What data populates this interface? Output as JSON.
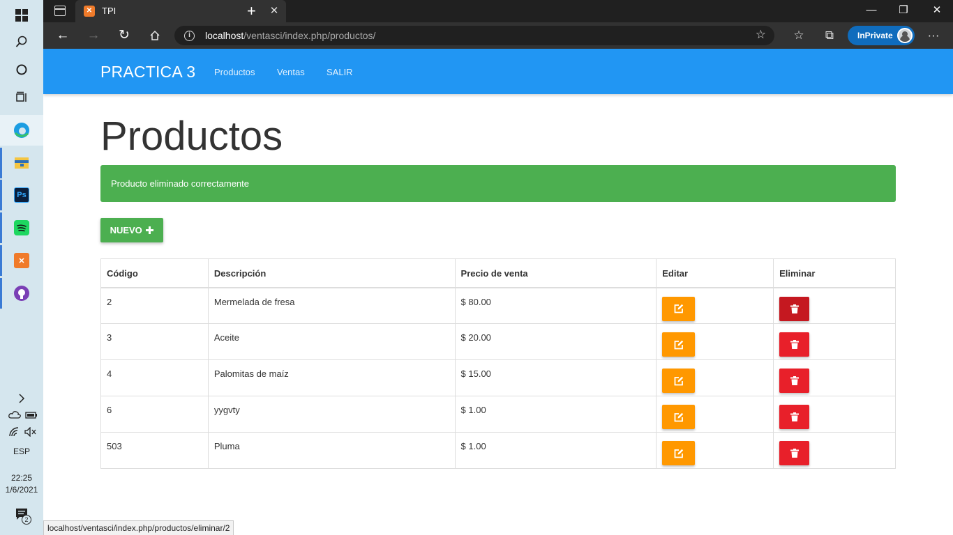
{
  "browser": {
    "tab_title": "TPI",
    "tab_favicon": "xampp-icon",
    "url_host": "localhost",
    "url_path": "/ventasci/index.php/productos/",
    "inprivate_label": "InPrivate"
  },
  "site": {
    "brand": "PRACTICA 3",
    "nav": [
      "Productos",
      "Ventas",
      "SALIR"
    ]
  },
  "page": {
    "title": "Productos",
    "alert": "Producto eliminado correctamente",
    "new_button": "NUEVO",
    "table": {
      "headers": [
        "Código",
        "Descripción",
        "Precio de venta",
        "Editar",
        "Eliminar"
      ],
      "rows": [
        {
          "code": "2",
          "desc": "Mermelada de fresa",
          "price": "$ 80.00"
        },
        {
          "code": "3",
          "desc": "Aceite",
          "price": "$ 20.00"
        },
        {
          "code": "4",
          "desc": "Palomitas de maíz",
          "price": "$ 15.00"
        },
        {
          "code": "6",
          "desc": "yygvty",
          "price": "$ 1.00"
        },
        {
          "code": "503",
          "desc": "Pluma",
          "price": "$ 1.00"
        }
      ]
    }
  },
  "status_url": "localhost/ventasci/index.php/productos/eliminar/2",
  "taskbar": {
    "lang": "ESP",
    "time": "22:25",
    "date": "1/6/2021",
    "notifications": "2"
  },
  "colors": {
    "navbar": "#2196f3",
    "success": "#4caf50",
    "edit": "#ff9800",
    "delete": "#e8202a"
  }
}
